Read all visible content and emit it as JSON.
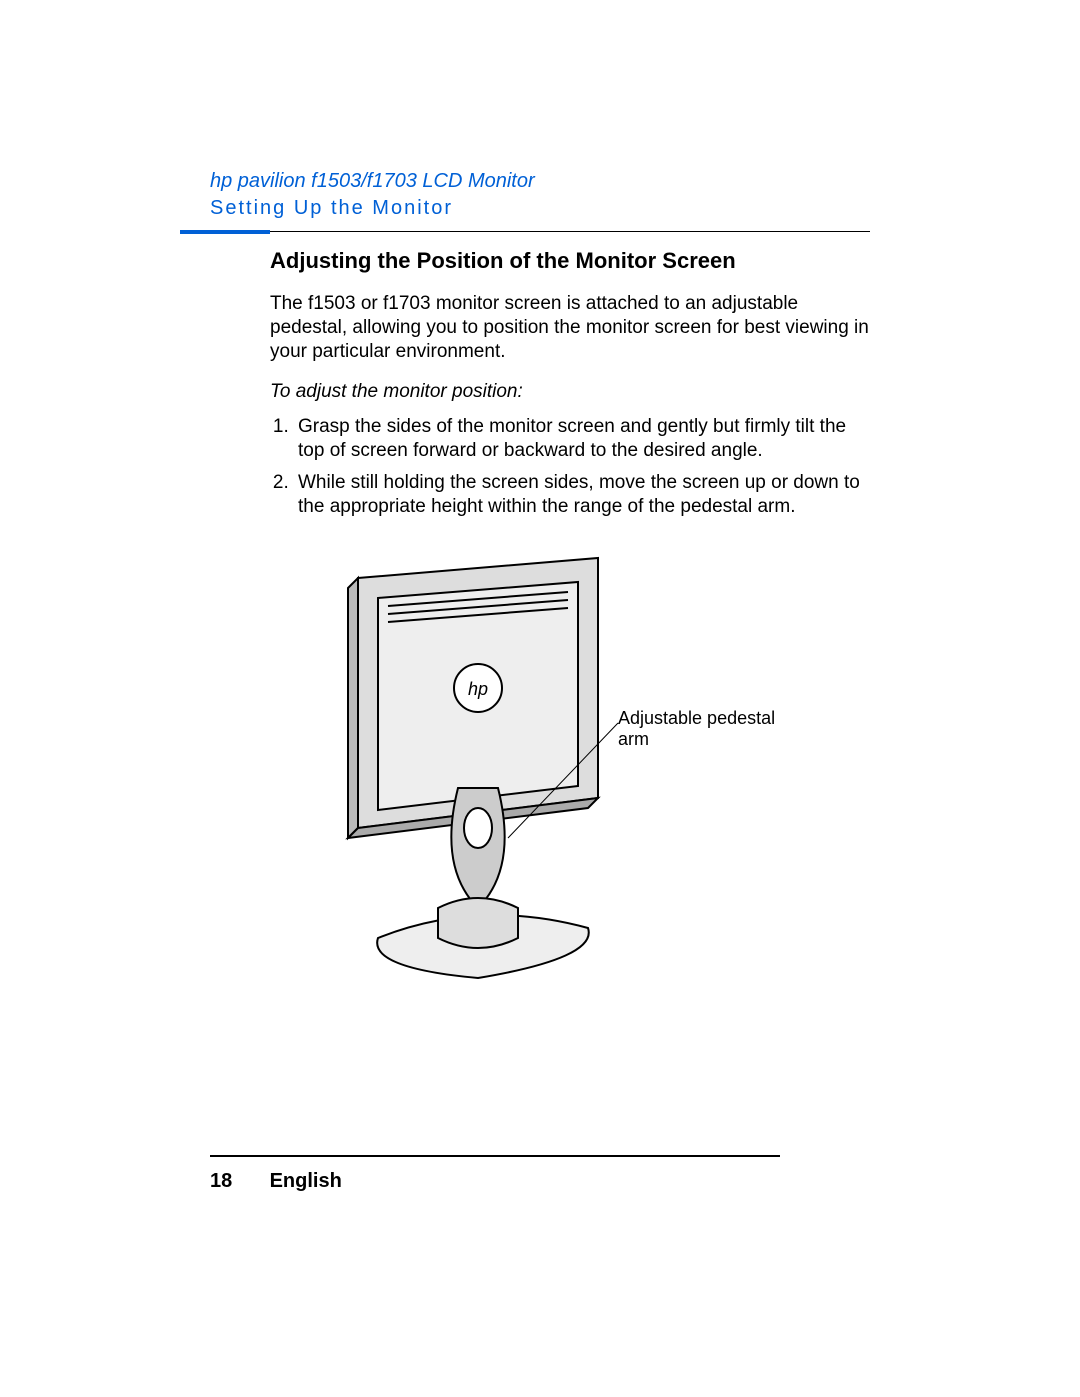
{
  "header": {
    "product": "hp pavilion f1503/f1703 LCD Monitor",
    "section": "Setting Up the Monitor"
  },
  "title": "Adjusting the Position of the Monitor Screen",
  "intro": "The f1503 or f1703 monitor screen is attached to an adjustable pedestal, allowing you to position the monitor screen for best viewing in your particular environment.",
  "subhead": "To adjust the monitor position:",
  "steps": [
    "Grasp the sides of the monitor screen and gently but firmly tilt the top of screen forward or backward to the desired angle.",
    "While still holding the screen sides, move the screen up or down to the appropriate height within the range of the pedestal arm."
  ],
  "figure": {
    "callout": "Adjustable pedestal arm"
  },
  "footer": {
    "page": "18",
    "lang": "English"
  }
}
